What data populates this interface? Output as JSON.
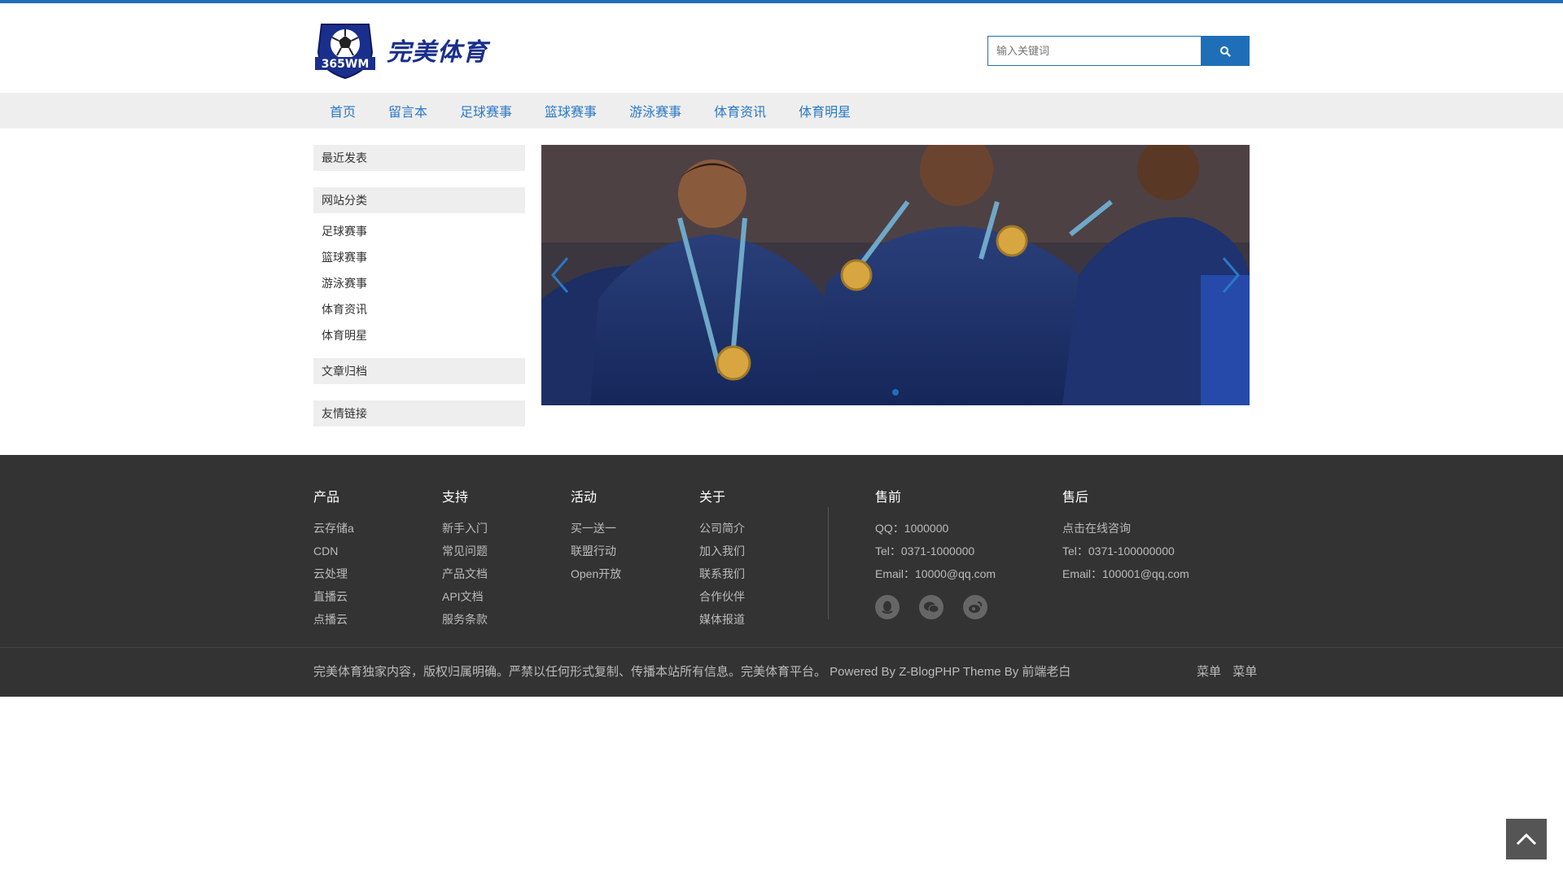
{
  "header": {
    "logo_text": "完美体育",
    "logo_badge_text": "365WM",
    "search_placeholder": "输入关键词"
  },
  "nav": {
    "items": [
      "首页",
      "留言本",
      "足球赛事",
      "篮球赛事",
      "游泳赛事",
      "体育资讯",
      "体育明星"
    ]
  },
  "sidebar": {
    "recent_title": "最近发表",
    "categories_title": "网站分类",
    "categories": [
      "足球赛事",
      "篮球赛事",
      "游泳赛事",
      "体育资讯",
      "体育明星"
    ],
    "archive_title": "文章归档",
    "links_title": "友情链接"
  },
  "slider": {
    "active_index": 0,
    "slide_count": 1
  },
  "footer": {
    "columns": [
      {
        "title": "产品",
        "items": [
          "云存储a",
          "CDN",
          "云处理",
          "直播云",
          "点播云"
        ]
      },
      {
        "title": "支持",
        "items": [
          "新手入门",
          "常见问题",
          "产品文档",
          "API文档",
          "服务条款"
        ]
      },
      {
        "title": "活动",
        "items": [
          "买一送一",
          "联盟行动",
          "Open开放"
        ]
      },
      {
        "title": "关于",
        "items": [
          "公司简介",
          "加入我们",
          "联系我们",
          "合作伙伴",
          "媒体报道"
        ]
      }
    ],
    "presale": {
      "title": "售前",
      "lines": [
        "QQ：1000000",
        "Tel：0371-1000000",
        "Email：10000@qq.com"
      ]
    },
    "aftersale": {
      "title": "售后",
      "lines": [
        "点击在线咨询",
        "Tel：0371-100000000",
        "Email：100001@qq.com"
      ]
    },
    "copyright": "完美体育独家内容，版权归属明确。严禁以任何形式复制、传播本站所有信息。完美体育平台。 Powered By Z-BlogPHP Theme By 前端老白",
    "menu": [
      "菜单",
      "菜单"
    ]
  },
  "colors": {
    "accent": "#1f6fb8",
    "nav_text": "#2b78c5",
    "footer_bg": "#333333"
  },
  "icons": [
    "search-icon",
    "qq-icon",
    "wechat-icon",
    "weibo-icon",
    "chevron-left-icon",
    "chevron-right-icon",
    "chevron-up-icon"
  ]
}
